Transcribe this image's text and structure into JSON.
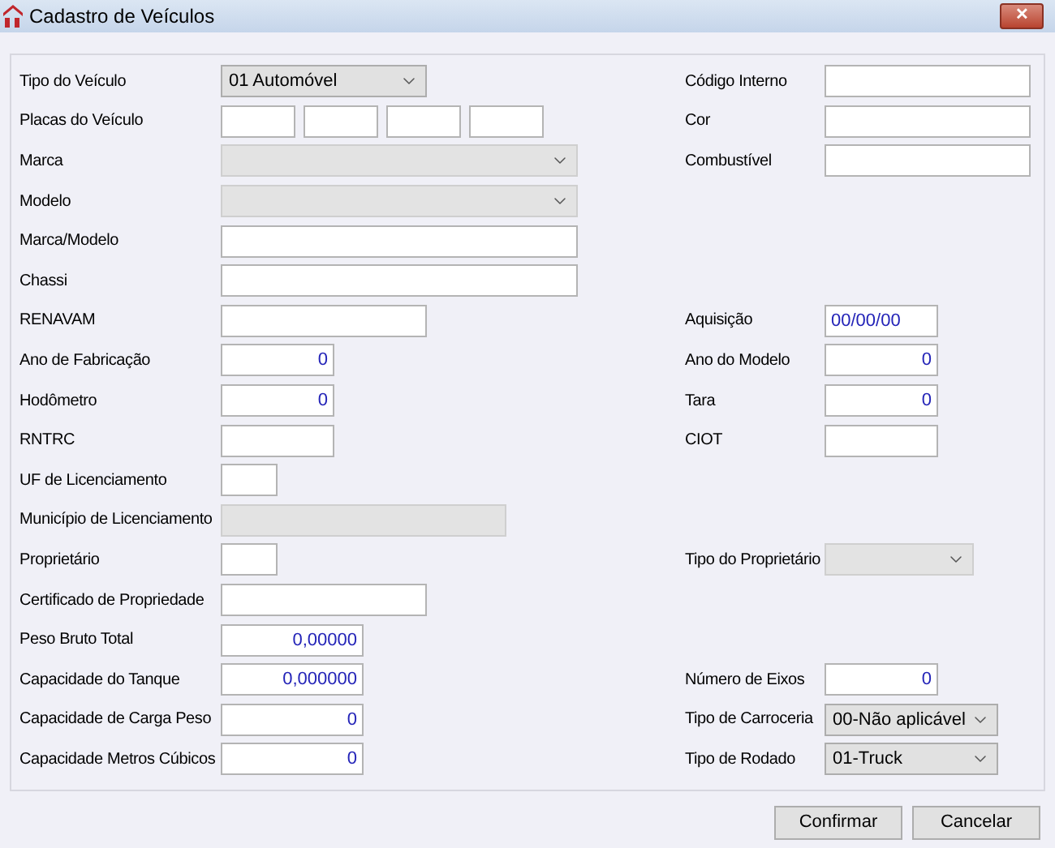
{
  "window": {
    "title": "Cadastro de Veículos",
    "close": "✕"
  },
  "rows": [
    {
      "left": {
        "label": "Tipo do Veículo",
        "kind": "select",
        "disabled": false,
        "value": "01 Automóvel"
      },
      "right": {
        "label": "Código Interno",
        "kind": "text",
        "disabled": false
      }
    },
    {
      "left": {
        "label": "Placas do Veículo",
        "kind": "plates",
        "disabled": false
      },
      "right": {
        "label": "Cor",
        "kind": "text",
        "disabled": false
      }
    },
    {
      "left": {
        "label": "Marca",
        "kind": "select",
        "disabled": true
      },
      "right": {
        "label": "Combustível",
        "kind": "text",
        "disabled": false
      }
    },
    {
      "left": {
        "label": "Modelo",
        "kind": "select",
        "disabled": true
      }
    },
    {
      "left": {
        "label": "Marca/Modelo",
        "kind": "text",
        "disabled": false
      }
    },
    {
      "left": {
        "label": "Chassi",
        "kind": "text",
        "disabled": false
      }
    },
    {
      "left": {
        "label": "RENAVAM",
        "kind": "text",
        "disabled": false
      },
      "right": {
        "label": "Aquisição",
        "kind": "date",
        "disabled": false,
        "value": "00/00/00"
      }
    },
    {
      "left": {
        "label": "Ano de Fabricação",
        "kind": "number",
        "disabled": false,
        "value": "0"
      },
      "right": {
        "label": "Ano do Modelo",
        "kind": "number",
        "disabled": false,
        "value": "0"
      }
    },
    {
      "left": {
        "label": "Hodômetro",
        "kind": "number",
        "disabled": false,
        "value": "0"
      },
      "right": {
        "label": "Tara",
        "kind": "number",
        "disabled": false,
        "value": "0"
      }
    },
    {
      "left": {
        "label": "RNTRC",
        "kind": "text",
        "disabled": false
      },
      "right": {
        "label": "CIOT",
        "kind": "text",
        "disabled": false
      }
    },
    {
      "left": {
        "label": "UF de Licenciamento",
        "kind": "text",
        "disabled": false
      }
    },
    {
      "left": {
        "label": "Município de Licenciamento",
        "kind": "text",
        "disabled": true
      }
    },
    {
      "left": {
        "label": "Proprietário",
        "kind": "text",
        "disabled": false
      },
      "right": {
        "label": "Tipo do Proprietário",
        "kind": "select",
        "disabled": true
      }
    },
    {
      "left": {
        "label": "Certificado de Propriedade",
        "kind": "text",
        "disabled": false
      }
    },
    {
      "left": {
        "label": "Peso Bruto Total",
        "kind": "number",
        "disabled": false,
        "value": "0,00000"
      }
    },
    {
      "left": {
        "label": "Capacidade do Tanque",
        "kind": "number",
        "disabled": false,
        "value": "0,000000"
      },
      "right": {
        "label": "Número de Eixos",
        "kind": "number",
        "disabled": false,
        "value": "0"
      }
    },
    {
      "left": {
        "label": "Capacidade de Carga Peso",
        "kind": "number",
        "disabled": false,
        "value": "0"
      },
      "right": {
        "label": "Tipo de Carroceria",
        "kind": "select",
        "disabled": false,
        "value": "00-Não aplicável"
      }
    },
    {
      "left": {
        "label": "Capacidade Metros Cúbicos",
        "kind": "number",
        "disabled": false,
        "value": "0"
      },
      "right": {
        "label": "Tipo de Rodado",
        "kind": "select",
        "disabled": false,
        "value": "01-Truck"
      }
    }
  ],
  "buttons": [
    "Confirmar",
    "Cancelar"
  ]
}
